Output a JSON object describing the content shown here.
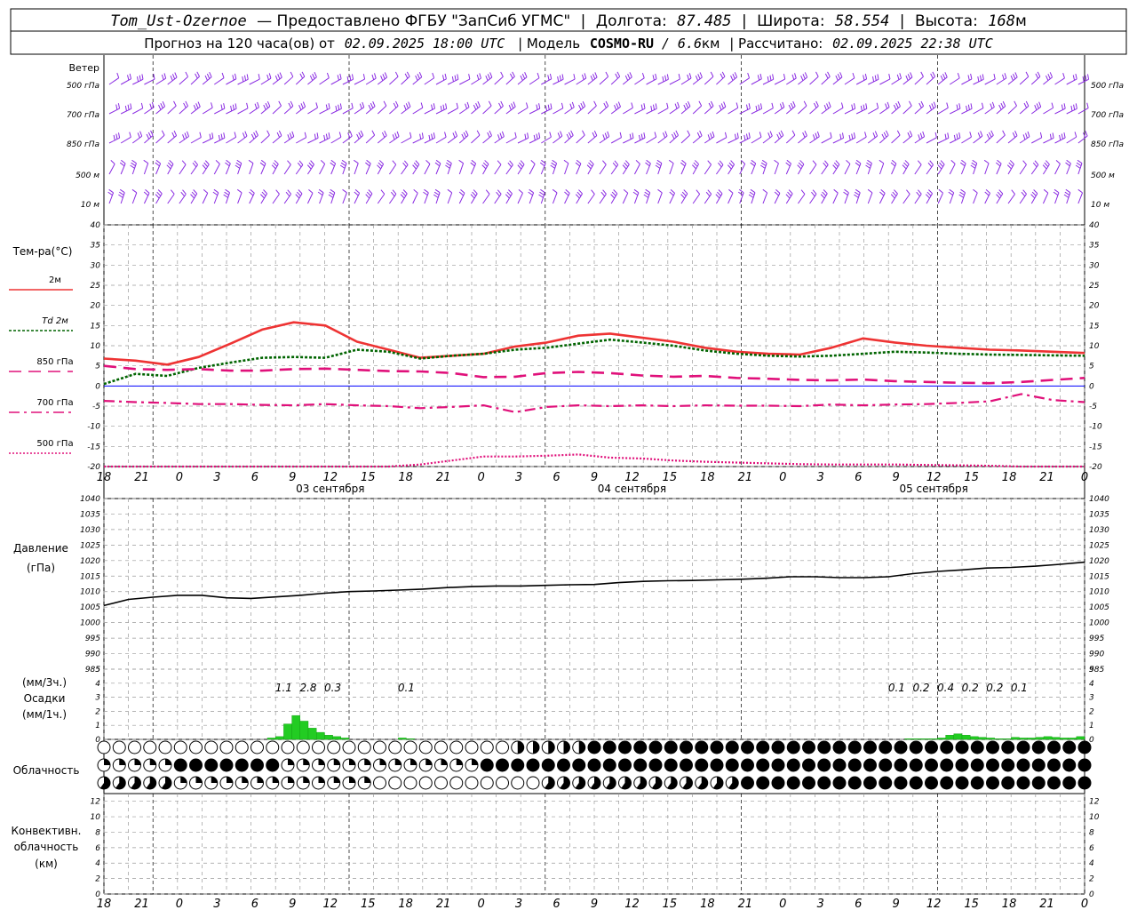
{
  "header": {
    "station": "Tom_Ust-Ozernoe",
    "provider_prefix": "—  Предоставлено ФГБУ \"ЗапСиб УГМС\"",
    "lon_label": "Долгота:",
    "lon_value": "87.485",
    "lat_label": "Широта:",
    "lat_value": "58.554",
    "alt_label": "Высота:",
    "alt_value": "168",
    "alt_unit": "м",
    "forecast_prefix": "Прогноз на 120 часа(ов) от",
    "forecast_start": "02.09.2025 18:00 UTC",
    "model_label": "| Модель",
    "model_name": "COSMO-RU",
    "model_res": "/ 6.6",
    "model_res_unit": "км",
    "computed_label": "| Рассчитано:",
    "computed_value": "02.09.2025 22:38 UTC"
  },
  "time_axis": {
    "ticks": [
      "18",
      "21",
      "0",
      "3",
      "6",
      "9",
      "12",
      "15",
      "18",
      "21",
      "0",
      "3",
      "6",
      "9",
      "12",
      "15",
      "18",
      "21",
      "0",
      "3",
      "6",
      "9",
      "12",
      "15",
      "18",
      "21",
      "0"
    ],
    "day_labels": [
      "03 сентября",
      "04 сентября",
      "05 сентября"
    ]
  },
  "wind_panel": {
    "title": "Ветер",
    "levels": [
      "500 гПа",
      "700 гПа",
      "850 гПа",
      "500  м",
      "10   м"
    ]
  },
  "temperature_panel": {
    "title": "Тем-ра(°С)",
    "legend": [
      {
        "label": "2м",
        "color": "#ee3333",
        "style": "solid"
      },
      {
        "label": "Td  2м",
        "color": "#006400",
        "style": "dotted"
      },
      {
        "label": "850 гПа",
        "color": "#e0107a",
        "style": "dashed"
      },
      {
        "label": "700 гПа",
        "color": "#e0107a",
        "style": "dashdot"
      },
      {
        "label": "500 гПа",
        "color": "#e0107a",
        "style": "fine-dotted"
      }
    ],
    "y_ticks": [
      "40",
      "35",
      "30",
      "25",
      "20",
      "15",
      "10",
      "5",
      "0",
      "-5",
      "-10",
      "-15",
      "-20"
    ]
  },
  "pressure_panel": {
    "title": "Давление",
    "unit": "(гПа)",
    "y_ticks": [
      "1040",
      "1035",
      "1030",
      "1025",
      "1020",
      "1015",
      "1010",
      "1005",
      "1000",
      "995",
      "990",
      "985"
    ]
  },
  "precip_panel": {
    "unit_3h": "(мм/3ч.)",
    "title": "Осадки",
    "unit_1h": "(мм/1ч.)",
    "y_ticks": [
      "5",
      "4",
      "3",
      "2",
      "1",
      "0"
    ],
    "totals": [
      {
        "hour": 22,
        "value": "1.1"
      },
      {
        "hour": 25,
        "value": "2.8"
      },
      {
        "hour": 28,
        "value": "0.3"
      },
      {
        "hour": 37,
        "value": "0.1"
      },
      {
        "hour": 97,
        "value": "0.1"
      },
      {
        "hour": 100,
        "value": "0.2"
      },
      {
        "hour": 103,
        "value": "0.4"
      },
      {
        "hour": 106,
        "value": "0.2"
      },
      {
        "hour": 109,
        "value": "0.2"
      },
      {
        "hour": 112,
        "value": "0.1"
      }
    ]
  },
  "cloud_panel": {
    "title": "Облачность"
  },
  "convective_panel": {
    "title_line1": "Конвективн.",
    "title_line2": "облачность",
    "unit": "(км)",
    "y_ticks": [
      "12",
      "10",
      "8",
      "6",
      "4",
      "2",
      "0"
    ]
  },
  "colors": {
    "wind": "#8a2be2",
    "temp2m": "#ee3333",
    "dewpoint": "#006400",
    "upper": "#e0107a",
    "pressure": "#000000",
    "precip": "#22cc22",
    "convective": "#ee8833",
    "zero_line": "#0000ff",
    "grid": "#9a9a9a"
  },
  "chart_data": [
    {
      "type": "line",
      "name": "temperature",
      "x_hours": [
        0,
        3,
        6,
        9,
        12,
        15,
        18,
        21,
        24,
        27,
        30,
        33,
        36,
        39,
        42,
        45,
        48,
        51,
        54,
        57,
        60,
        63,
        66,
        69,
        72,
        75,
        78,
        81,
        84,
        87,
        90,
        93,
        96,
        99,
        102,
        105,
        108,
        111,
        114,
        117,
        120
      ],
      "series": [
        {
          "name": "2м",
          "values": [
            6.8,
            6.3,
            5.3,
            7.2,
            10.5,
            14.0,
            15.8,
            15.0,
            11.0,
            9.0,
            7.0,
            7.5,
            8.0,
            9.8,
            10.8,
            12.5,
            13.0,
            12.0,
            11.0,
            9.5,
            8.5,
            8.0,
            7.8,
            9.5,
            11.8,
            10.8,
            10.0,
            9.5,
            9.0,
            8.8,
            8.5,
            8.2
          ]
        },
        {
          "name": "Td  2м",
          "values": [
            0.5,
            3.0,
            2.5,
            4.5,
            5.8,
            7.0,
            7.2,
            7.0,
            9.0,
            8.5,
            6.8,
            7.5,
            8.0,
            9.0,
            9.5,
            10.5,
            11.5,
            10.8,
            10.0,
            8.8,
            8.0,
            7.5,
            7.3,
            7.5,
            8.0,
            8.5,
            8.3,
            8.0,
            7.8,
            7.7,
            7.6,
            7.5
          ]
        },
        {
          "name": "850 гПа",
          "values": [
            5.0,
            4.2,
            4.0,
            4.2,
            3.8,
            3.8,
            4.2,
            4.3,
            4.0,
            3.7,
            3.6,
            3.2,
            2.2,
            2.3,
            3.2,
            3.5,
            3.2,
            2.6,
            2.3,
            2.5,
            2.0,
            1.8,
            1.5,
            1.4,
            1.6,
            1.2,
            1.0,
            0.8,
            0.7,
            1.0,
            1.5,
            2.0
          ]
        },
        {
          "name": "700 гПа",
          "values": [
            -3.7,
            -4.0,
            -4.2,
            -4.5,
            -4.5,
            -4.7,
            -4.8,
            -4.5,
            -4.8,
            -5.0,
            -5.5,
            -5.2,
            -4.8,
            -6.5,
            -5.2,
            -4.8,
            -5.0,
            -4.8,
            -5.0,
            -4.8,
            -4.9,
            -4.9,
            -5.0,
            -4.6,
            -4.8,
            -4.6,
            -4.5,
            -4.2,
            -3.8,
            -2.0,
            -3.5,
            -4.0
          ]
        },
        {
          "name": "500 гПа",
          "values": [
            -20.0,
            -20.5,
            -21,
            -21,
            -21,
            -21,
            -21,
            -21,
            -21,
            -20.5,
            -19.5,
            -18.5,
            -17.5,
            -17.5,
            -17.3,
            -17.0,
            -17.8,
            -18.0,
            -18.5,
            -18.8,
            -19.0,
            -19.2,
            -19.4,
            -19.5,
            -19.5,
            -19.5,
            -19.6,
            -19.7,
            -19.8,
            -20.0,
            -20.0,
            -20.0
          ]
        }
      ],
      "ylim": [
        -20,
        40
      ]
    },
    {
      "type": "line",
      "name": "pressure",
      "x_hours": [
        0,
        3,
        6,
        9,
        12,
        15,
        18,
        21,
        24,
        27,
        30,
        33,
        36,
        39,
        42,
        45,
        48,
        51,
        54,
        57,
        60,
        63,
        66,
        69,
        72,
        75,
        78,
        81,
        84,
        87,
        90,
        93,
        96,
        99,
        102,
        105,
        108,
        111,
        114,
        117,
        120
      ],
      "series": [
        {
          "name": "pressure",
          "values": [
            1005.5,
            1007.5,
            1008.2,
            1008.8,
            1008.8,
            1008.0,
            1007.8,
            1008.3,
            1008.8,
            1009.5,
            1010.0,
            1010.2,
            1010.5,
            1010.8,
            1011.3,
            1011.6,
            1011.8,
            1011.8,
            1012.0,
            1012.2,
            1012.3,
            1012.9,
            1013.3,
            1013.5,
            1013.6,
            1013.8,
            1014.0,
            1014.3,
            1014.8,
            1014.8,
            1014.5,
            1014.5,
            1014.8,
            1015.8,
            1016.5,
            1017.0,
            1017.6,
            1017.8,
            1018.2,
            1018.8,
            1019.5
          ]
        }
      ],
      "ylim": [
        985,
        1040
      ]
    },
    {
      "type": "bar",
      "name": "precipitation_1h",
      "x_hours": [
        20,
        21,
        22,
        23,
        24,
        25,
        26,
        27,
        28,
        29,
        30,
        31,
        32,
        33,
        34,
        35,
        36,
        37,
        38,
        39,
        40,
        41,
        42,
        43,
        44,
        45,
        46,
        47,
        48,
        49,
        50,
        51,
        52,
        53,
        54,
        55,
        56,
        57,
        58,
        59,
        60,
        61,
        62,
        63,
        64,
        65,
        66,
        67,
        68,
        69,
        70,
        71,
        72,
        73,
        74,
        75,
        76,
        77,
        78,
        79,
        80,
        81,
        82,
        83,
        84,
        85,
        86,
        87,
        88,
        89,
        90,
        91,
        92,
        93,
        94,
        95,
        96,
        97,
        98,
        99,
        100,
        101,
        102,
        103,
        104,
        105,
        106,
        107,
        108,
        109,
        110,
        111,
        112,
        113,
        114,
        115,
        116,
        117,
        118,
        119,
        120
      ],
      "values": [
        0,
        0.1,
        0.2,
        1.1,
        1.7,
        1.3,
        0.8,
        0.5,
        0.3,
        0.2,
        0.1,
        0,
        0,
        0,
        0,
        0,
        0,
        0.1,
        0.05,
        0,
        0,
        0,
        0,
        0,
        0,
        0,
        0,
        0,
        0,
        0,
        0,
        0,
        0,
        0,
        0,
        0,
        0,
        0,
        0,
        0,
        0,
        0,
        0,
        0,
        0,
        0,
        0,
        0,
        0,
        0,
        0,
        0,
        0,
        0,
        0,
        0,
        0,
        0,
        0,
        0,
        0,
        0,
        0,
        0,
        0,
        0,
        0,
        0,
        0,
        0,
        0,
        0,
        0,
        0,
        0,
        0,
        0,
        0,
        0,
        0.05,
        0.05,
        0.05,
        0.05,
        0.1,
        0.3,
        0.4,
        0.3,
        0.2,
        0.15,
        0.1,
        0.05,
        0.05,
        0.15,
        0.1,
        0.1,
        0.15,
        0.2,
        0.15,
        0.1,
        0.1,
        0.2,
        0.1,
        0.05,
        0,
        0
      ],
      "ylim": [
        0,
        5
      ]
    },
    {
      "type": "bar",
      "name": "convective_cloud_top",
      "x_hours": [
        20,
        21,
        22,
        23,
        24,
        25,
        26,
        27,
        28,
        29,
        30,
        31,
        32,
        33,
        34,
        35,
        36,
        37,
        38,
        39,
        40,
        41,
        42,
        43,
        44,
        45,
        46,
        47,
        48,
        49,
        50,
        51,
        52,
        53,
        54,
        55,
        56,
        57,
        58,
        59,
        60,
        61,
        62,
        63,
        64,
        65,
        66,
        67,
        68,
        69,
        70,
        71,
        72,
        73,
        74,
        75,
        76,
        77,
        78,
        79,
        80,
        81,
        82,
        83,
        84,
        85,
        86,
        87,
        88,
        89,
        90,
        91,
        92,
        93,
        94,
        95,
        96,
        97,
        98,
        99,
        100,
        101,
        102,
        103,
        104,
        105,
        106,
        107,
        108,
        109,
        110,
        111,
        112,
        113,
        114,
        115,
        116,
        117,
        118,
        119,
        120
      ],
      "values": [
        0,
        0,
        0,
        0,
        0,
        0,
        0,
        0,
        0,
        0,
        0,
        0,
        0,
        0,
        0,
        0,
        0,
        0,
        0,
        0,
        0,
        0,
        0,
        0,
        0,
        0,
        0,
        0,
        0,
        0,
        0,
        0,
        0,
        0,
        0,
        0,
        0,
        0,
        0,
        0,
        0,
        0,
        0,
        0,
        0,
        0,
        0,
        0,
        0,
        0,
        0,
        0,
        0,
        0,
        0,
        0,
        0,
        0,
        0,
        0,
        0,
        0,
        0,
        0,
        0,
        0,
        0,
        0,
        0,
        0,
        0,
        0,
        0,
        0,
        0,
        0,
        0,
        0,
        0,
        0,
        0,
        0,
        0,
        0,
        0,
        0,
        0,
        0,
        0,
        0,
        0,
        0,
        0,
        0,
        0,
        0,
        0,
        0,
        0,
        0,
        0
      ],
      "ylim": [
        0,
        13
      ]
    }
  ]
}
